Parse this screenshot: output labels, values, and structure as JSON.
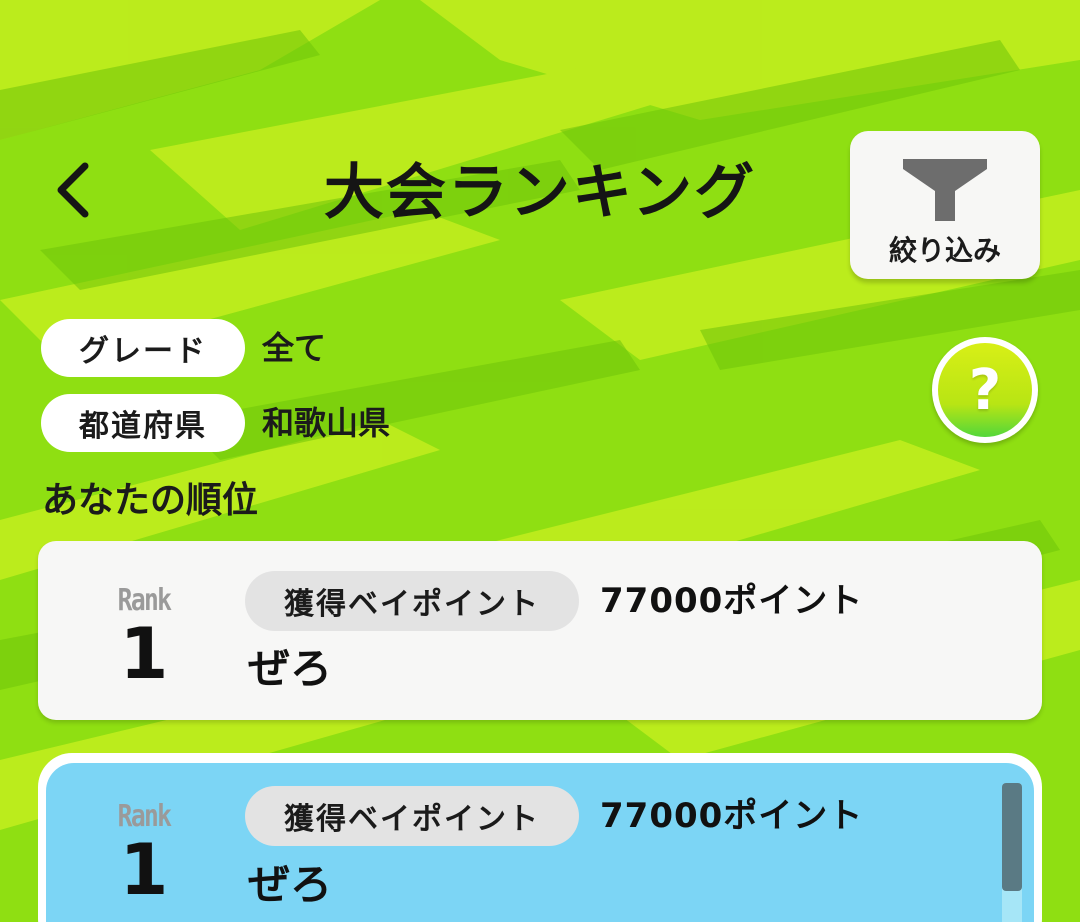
{
  "header": {
    "title": "大会ランキング",
    "filter_label": "絞り込み",
    "help_label": "?"
  },
  "filters": [
    {
      "label": "グレード",
      "value": "全て"
    },
    {
      "label": "都道府県",
      "value": "和歌山県"
    }
  ],
  "my_rank": {
    "heading": "あなたの順位",
    "rank_word": "Rank",
    "rank": "1",
    "points_label": "獲得ベイポイント",
    "points_value": "77000ポイント",
    "name": "ぜろ"
  },
  "ranking_list": [
    {
      "rank_word": "Rank",
      "rank": "1",
      "points_label": "獲得ベイポイント",
      "points_value": "77000ポイント",
      "name": "ぜろ"
    }
  ],
  "colors": {
    "background": "#8fdf12",
    "stroke_dark": "#6fc40a",
    "stroke_light": "#c3ee1e",
    "highlight_row": "#7cd5f5",
    "card": "#f7f7f6"
  },
  "icons": {
    "back": "chevron-left-icon",
    "filter": "funnel-icon",
    "help": "question-icon"
  }
}
